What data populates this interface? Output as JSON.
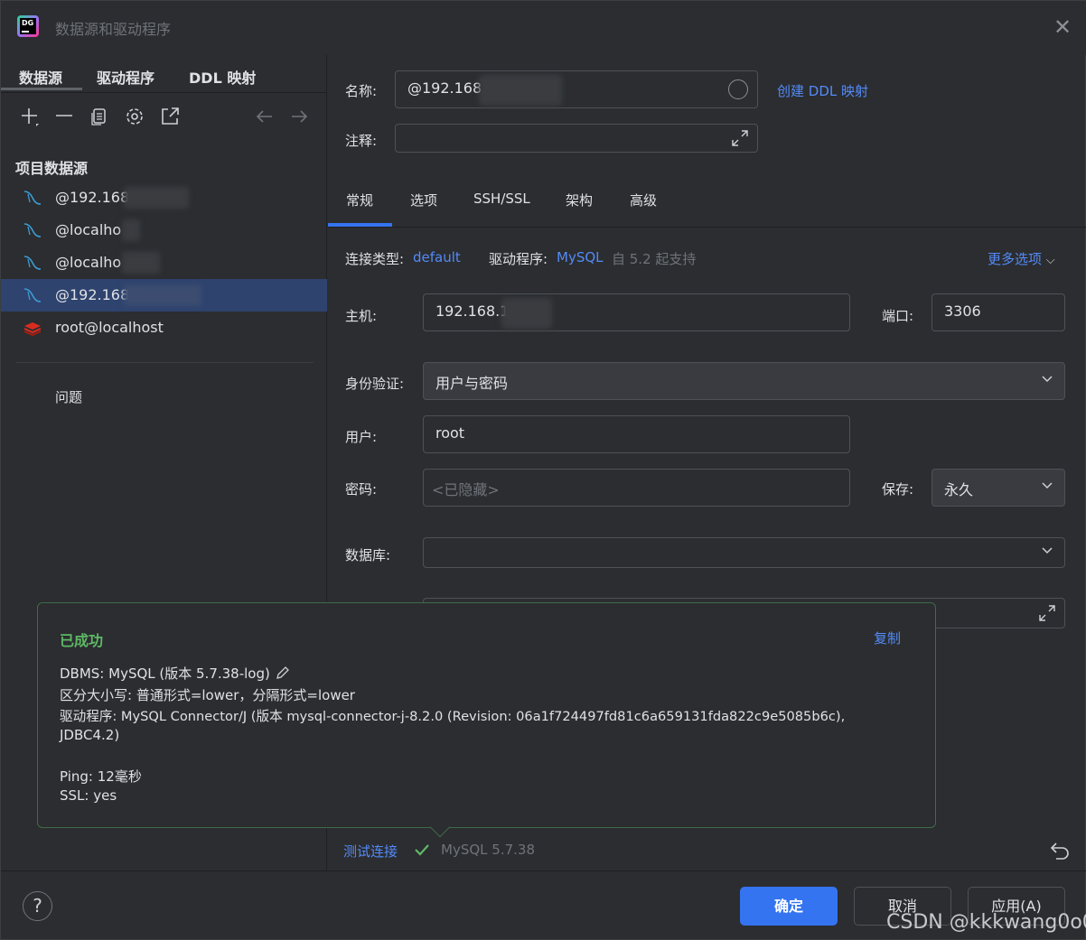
{
  "window": {
    "title": "数据源和驱动程序",
    "app_logo_text": "DG"
  },
  "left": {
    "tabs": [
      "数据源",
      "驱动程序",
      "DDL 映射"
    ],
    "section_title": "项目数据源",
    "datasources": [
      {
        "label": "@192.168",
        "icon": "mysql-icon",
        "selected": false
      },
      {
        "label": "@localho",
        "icon": "mysql-icon",
        "selected": false
      },
      {
        "label": "@localho",
        "icon": "mysql-icon",
        "selected": false
      },
      {
        "label": "@192.168",
        "icon": "mysql-icon",
        "selected": true
      },
      {
        "label": "root@localhost",
        "icon": "redis-icon",
        "selected": false
      }
    ],
    "problems_label": "问题"
  },
  "right": {
    "name_label": "名称:",
    "name_value": "@192.168.",
    "create_ddl_link": "创建 DDL 映射",
    "comment_label": "注释:",
    "comment_value": "",
    "tabs": [
      "常规",
      "选项",
      "SSH/SSL",
      "架构",
      "高级"
    ],
    "conn_type_label": "连接类型:",
    "conn_type_value": "default",
    "driver_label": "驱动程序:",
    "driver_value": "MySQL",
    "driver_note": "自 5.2 起支持",
    "more_options": "更多选项",
    "host_label": "主机:",
    "host_value": "192.168.1",
    "port_label": "端口:",
    "port_value": "3306",
    "auth_label": "身份验证:",
    "auth_value": "用户与密码",
    "user_label": "用户:",
    "user_value": "root",
    "password_label": "密码:",
    "password_placeholder": "<已隐藏>",
    "save_label": "保存:",
    "save_value": "永久",
    "database_label": "数据库:",
    "database_value": ""
  },
  "popup": {
    "title": "已成功",
    "copy": "复制",
    "dbms": "DBMS: MySQL (版本 5.7.38-log)",
    "case": "区分大小写: 普通形式=lower，分隔形式=lower",
    "driver": "驱动程序: MySQL Connector/J (版本 mysql-connector-j-8.2.0 (Revision: 06a1f724497fd81c6a659131fda822c9e5085b6c),",
    "driver_cont": "JDBC4.2)",
    "ping": "Ping: 12毫秒",
    "ssl": "SSL: yes"
  },
  "test": {
    "link": "测试连接",
    "status": "MySQL 5.7.38"
  },
  "buttons": {
    "help": "?",
    "ok": "确定",
    "cancel": "取消",
    "apply": "应用(A)"
  },
  "watermark": "CSDN @kkkwang0o0",
  "colors": {
    "accent": "#3574f0",
    "link": "#548af7",
    "success": "#5fb865",
    "selection": "#2e436e"
  }
}
